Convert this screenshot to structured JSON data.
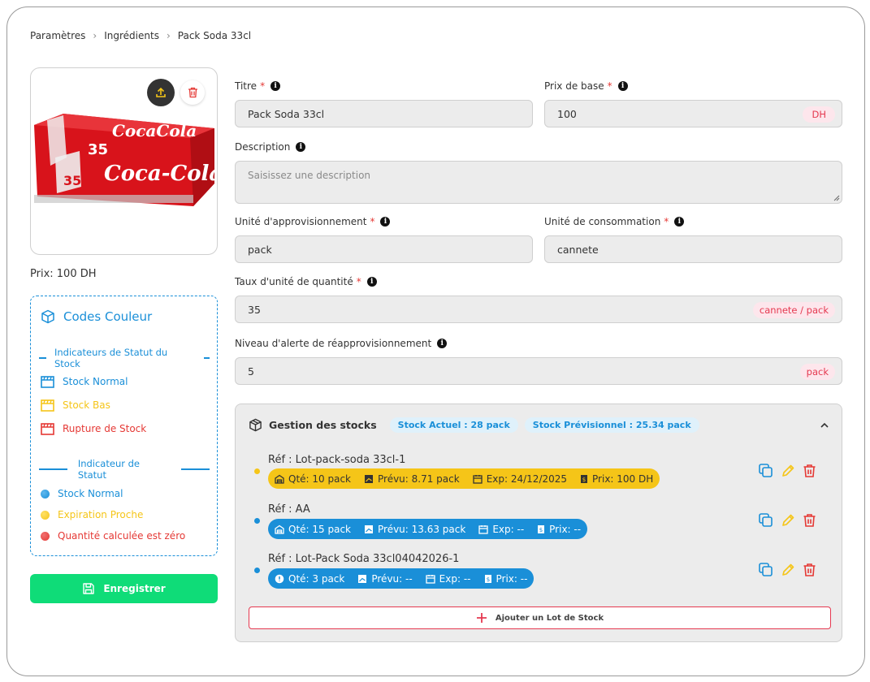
{
  "breadcrumb": [
    "Paramètres",
    "Ingrédients",
    "Pack Soda 33cl"
  ],
  "product": {
    "image_label": "Coca-Cola 35 Can Pack",
    "price_text": "Prix: 100 DH"
  },
  "color_codes": {
    "title": "Codes Couleur",
    "section_stock": "Indicateurs de Statut du Stock",
    "stock_items": [
      {
        "label": "Stock Normal",
        "color": "#1a8fd8"
      },
      {
        "label": "Stock Bas",
        "color": "#f5c518"
      },
      {
        "label": "Rupture de Stock",
        "color": "#e53935"
      }
    ],
    "section_status": "Indicateur de Statut",
    "status_items": [
      {
        "label": "Stock Normal",
        "color": "#1a8fd8"
      },
      {
        "label": "Expiration Proche",
        "color": "#f5c518"
      },
      {
        "label": "Quantité calculée est zéro",
        "color": "#e53935"
      }
    ]
  },
  "save_label": "Enregistrer",
  "form": {
    "title_label": "Titre",
    "title_value": "Pack Soda 33cl",
    "base_price_label": "Prix de base",
    "base_price_value": "100",
    "base_price_suffix": "DH",
    "description_label": "Description",
    "description_placeholder": "Saisissez une description",
    "supply_unit_label": "Unité d'approvisionnement",
    "supply_unit_value": "pack",
    "consumption_unit_label": "Unité de consommation",
    "consumption_unit_value": "cannete",
    "rate_label": "Taux d'unité de quantité",
    "rate_value": "35",
    "rate_suffix": "cannete / pack",
    "alert_label": "Niveau d'alerte de réapprovisionnement",
    "alert_value": "5",
    "alert_suffix": "pack"
  },
  "stock": {
    "title": "Gestion des stocks",
    "current": "Stock Actuel : 28 pack",
    "forecast": "Stock Prévisionnel : 25.34 pack",
    "lots": [
      {
        "ref": "Réf : Lot-pack-soda 33cl-1",
        "qty": "Qté: 10 pack",
        "forecast": "Prévu: 8.71 pack",
        "exp": "Exp: 24/12/2025",
        "price": "Prix: 100 DH",
        "color": "#f5c518",
        "text_color": "#333333"
      },
      {
        "ref": "Réf : AA",
        "qty": "Qté: 15 pack",
        "forecast": "Prévu: 13.63 pack",
        "exp": "Exp: --",
        "price": "Prix: --",
        "color": "#1a8fd8",
        "text_color": "#ffffff"
      },
      {
        "ref": "Réf : Lot-Pack Soda 33cl04042026-1",
        "qty": "Qté: 3 pack",
        "forecast": "Prévu: --",
        "exp": "Exp: --",
        "price": "Prix: --",
        "color": "#1a8fd8",
        "text_color": "#ffffff"
      }
    ],
    "add_label": "Ajouter un Lot de Stock"
  }
}
